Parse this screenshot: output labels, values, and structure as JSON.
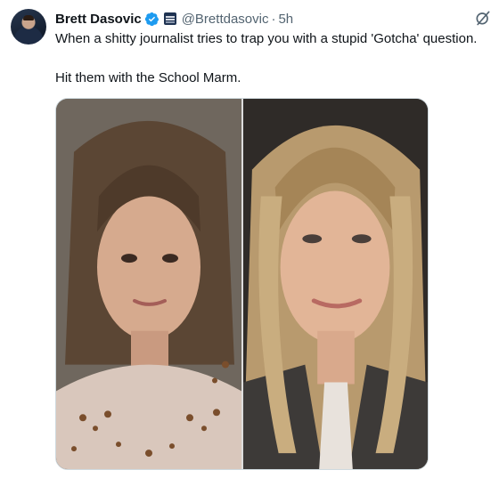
{
  "tweet": {
    "author_name": "Brett Dasovic",
    "handle": "@Brettdasovic",
    "separator": "·",
    "time": "5h",
    "text_line1": "When a shitty journalist tries to trap you with a stupid 'Gotcha' question.",
    "text_line2": "Hit them with the School Marm."
  },
  "icons": {
    "verified": "verified-badge-icon",
    "affiliation": "affiliation-badge-icon",
    "grok": "grok-icon"
  },
  "colors": {
    "verified": "#1d9bf0",
    "secondary_text": "#536471",
    "primary_text": "#0f1419"
  }
}
